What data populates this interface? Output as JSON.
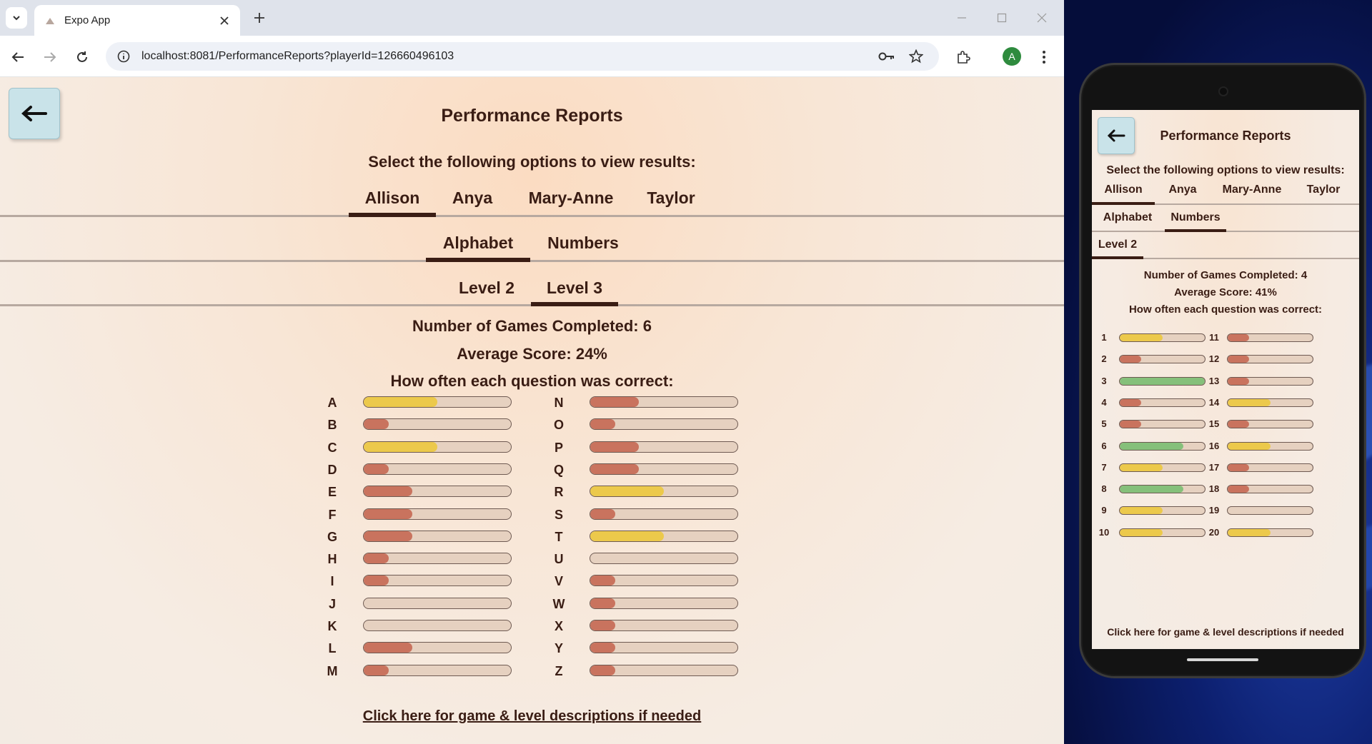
{
  "browser": {
    "tab_title": "Expo App",
    "url": "localhost:8081/PerformanceReports?playerId=126660496103",
    "profile_initial": "A"
  },
  "app": {
    "title": "Performance Reports",
    "select_label": "Select the following options to view results:",
    "players": [
      "Allison",
      "Anya",
      "Mary-Anne",
      "Taylor"
    ],
    "active_player": "Allison",
    "categories": [
      "Alphabet",
      "Numbers"
    ],
    "active_category": "Alphabet",
    "levels": [
      "Level 2",
      "Level 3"
    ],
    "active_level": "Level 3",
    "games_completed": "Number of Games Completed: 6",
    "average_score": "Average Score: 24%",
    "question_heading": "How often each question was correct:",
    "description_link": "Click here for game & level descriptions if needed",
    "colors": {
      "low": "#c9735e",
      "mid": "#ecc94b",
      "high": "#85c07a",
      "track": "#e6d1c0"
    },
    "questions": [
      {
        "label": "A",
        "fraction": 0.5
      },
      {
        "label": "B",
        "fraction": 0.17
      },
      {
        "label": "C",
        "fraction": 0.5
      },
      {
        "label": "D",
        "fraction": 0.17
      },
      {
        "label": "E",
        "fraction": 0.33
      },
      {
        "label": "F",
        "fraction": 0.33
      },
      {
        "label": "G",
        "fraction": 0.33
      },
      {
        "label": "H",
        "fraction": 0.17
      },
      {
        "label": "I",
        "fraction": 0.17
      },
      {
        "label": "J",
        "fraction": 0
      },
      {
        "label": "K",
        "fraction": 0
      },
      {
        "label": "L",
        "fraction": 0.33
      },
      {
        "label": "M",
        "fraction": 0.17
      },
      {
        "label": "N",
        "fraction": 0.33
      },
      {
        "label": "O",
        "fraction": 0.17
      },
      {
        "label": "P",
        "fraction": 0.33
      },
      {
        "label": "Q",
        "fraction": 0.33
      },
      {
        "label": "R",
        "fraction": 0.5
      },
      {
        "label": "S",
        "fraction": 0.17
      },
      {
        "label": "T",
        "fraction": 0.5
      },
      {
        "label": "U",
        "fraction": 0
      },
      {
        "label": "V",
        "fraction": 0.17
      },
      {
        "label": "W",
        "fraction": 0.17
      },
      {
        "label": "X",
        "fraction": 0.17
      },
      {
        "label": "Y",
        "fraction": 0.17
      },
      {
        "label": "Z",
        "fraction": 0.17
      }
    ]
  },
  "phone": {
    "title": "Performance Reports",
    "select_label": "Select the following options to view results:",
    "players": [
      "Allison",
      "Anya",
      "Mary-Anne",
      "Taylor"
    ],
    "active_player": "Allison",
    "categories": [
      "Alphabet",
      "Numbers"
    ],
    "active_category": "Numbers",
    "levels": [
      "Level 2"
    ],
    "active_level": "Level 2",
    "games_completed": "Number of Games Completed: 4",
    "average_score": "Average Score: 41%",
    "question_heading": "How often each question was correct:",
    "description_link": "Click here for game & level descriptions if needed",
    "questions": [
      {
        "label": "1",
        "fraction": 0.5
      },
      {
        "label": "2",
        "fraction": 0.25
      },
      {
        "label": "3",
        "fraction": 1.0
      },
      {
        "label": "4",
        "fraction": 0.25
      },
      {
        "label": "5",
        "fraction": 0.25
      },
      {
        "label": "6",
        "fraction": 0.75
      },
      {
        "label": "7",
        "fraction": 0.5
      },
      {
        "label": "8",
        "fraction": 0.75
      },
      {
        "label": "9",
        "fraction": 0.5
      },
      {
        "label": "10",
        "fraction": 0.5
      },
      {
        "label": "11",
        "fraction": 0.25
      },
      {
        "label": "12",
        "fraction": 0.25
      },
      {
        "label": "13",
        "fraction": 0.25
      },
      {
        "label": "14",
        "fraction": 0.5
      },
      {
        "label": "15",
        "fraction": 0.25
      },
      {
        "label": "16",
        "fraction": 0.5
      },
      {
        "label": "17",
        "fraction": 0.25
      },
      {
        "label": "18",
        "fraction": 0.25
      },
      {
        "label": "19",
        "fraction": 0
      },
      {
        "label": "20",
        "fraction": 0.5
      }
    ]
  }
}
